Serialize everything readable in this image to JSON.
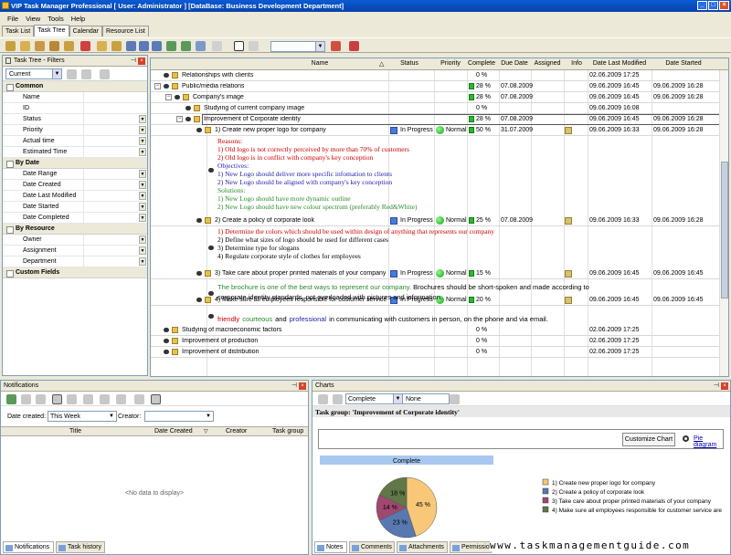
{
  "window": {
    "title": "VIP Task Manager Professional [ User: Administrator ] [DataBase: Business Development Department]"
  },
  "menu": [
    "File",
    "View",
    "Tools",
    "Help"
  ],
  "view_tabs": [
    "Task List",
    "Task Tree",
    "Calendar",
    "Resource List"
  ],
  "filter_panel": {
    "title": "Task Tree - Filters",
    "current": "Current",
    "sections": [
      {
        "name": "Common",
        "rows": [
          "Name",
          "ID",
          "Status",
          "Priority",
          "Actual time",
          "Estimated Time"
        ]
      },
      {
        "name": "By Date",
        "rows": [
          "Date Range",
          "Date Created",
          "Date Last Modified",
          "Date Started",
          "Date Completed"
        ]
      },
      {
        "name": "By Resource",
        "rows": [
          "Owner",
          "Assignment",
          "Department"
        ]
      },
      {
        "name": "Custom Fields",
        "rows": []
      }
    ]
  },
  "grid": {
    "columns": [
      "Name",
      "Status",
      "Priority",
      "Complete",
      "Due Date",
      "Assigned",
      "Info",
      "Date Last Modified",
      "Date Started"
    ],
    "rows": [
      {
        "name": "Relationships with clients",
        "status": "",
        "priority": "",
        "complete": "0 %",
        "due": "",
        "modified": "02.06.2009 17:25",
        "started": ""
      },
      {
        "name": "Public/media relations",
        "status": "",
        "priority": "",
        "complete": "28 %",
        "due": "07.08.2009",
        "modified": "09.06.2009 16:45",
        "started": "09.06.2009 16:28"
      },
      {
        "name": "Company's image",
        "status": "",
        "priority": "",
        "complete": "28 %",
        "due": "07.08.2009",
        "modified": "09.06.2009 16:45",
        "started": "09.06.2009 16:28"
      },
      {
        "name": "Studying of current company image",
        "status": "",
        "priority": "",
        "complete": "0 %",
        "due": "",
        "modified": "09.06.2009 16:08",
        "started": ""
      },
      {
        "name": "Improvement of Corporate identity",
        "status": "",
        "priority": "",
        "complete": "28 %",
        "due": "07.08.2009",
        "modified": "09.06.2009 16:45",
        "started": "09.06.2009 16:28"
      },
      {
        "name": "1) Create new proper logo for company",
        "status": "In Progress",
        "priority": "Normal",
        "complete": "50 %",
        "due": "31.07.2009",
        "modified": "09.06.2009 16:33",
        "started": "09.06.2009 16:28"
      },
      {
        "name": "2) Create a policy of corporate look",
        "status": "In Progress",
        "priority": "Normal",
        "complete": "25 %",
        "due": "07.08.2009",
        "modified": "09.06.2009 16:33",
        "started": "09.06.2009 16:28"
      },
      {
        "name": "3) Take care about proper printed materials of your company",
        "status": "In Progress",
        "priority": "Normal",
        "complete": "15 %",
        "due": "",
        "modified": "09.06.2009 16:45",
        "started": "09.06.2009 16:45"
      },
      {
        "name": "4) Make sure all employees responsible for customer service a",
        "status": "In Progress",
        "priority": "Normal",
        "complete": "20 %",
        "due": "",
        "modified": "09.06.2009 16:45",
        "started": "09.06.2009 16:45"
      },
      {
        "name": "Studying of macroeconomic factors",
        "status": "",
        "priority": "",
        "complete": "0 %",
        "due": "",
        "modified": "02.06.2009 17:25",
        "started": ""
      },
      {
        "name": "Improvement of production",
        "status": "",
        "priority": "",
        "complete": "0 %",
        "due": "",
        "modified": "02.06.2009 17:25",
        "started": ""
      },
      {
        "name": "Improvement of distribution",
        "status": "",
        "priority": "",
        "complete": "0 %",
        "due": "",
        "modified": "02.06.2009 17:25",
        "started": ""
      }
    ],
    "note1": {
      "reasons_title": "Reasons:",
      "reasons": [
        "1) Old logo is not correctly perceived by more than 70% of customers",
        "2) Old logo is in conflict with company's key conception"
      ],
      "objectives_title": "Objectives:",
      "objectives": [
        "1) New Logo should deliver more specific infomation to clients",
        "2) New Logo should be aligned with company's key conception"
      ],
      "solutions_title": "Solutions:",
      "solutions": [
        "1) New Logo should have more dynamic outline",
        "2) New Logo should have new colour spectrum (preferably Red&White)"
      ]
    },
    "note2": [
      "1) Determine the colors which should be used within design of anything that represents our company",
      "2) Define what sizes of logo should be used for different cases",
      "3) Determine type for slogans",
      "4) Regulate corporate style of clothes for employees"
    ],
    "note3": {
      "highlight": "The brochure is one of the best ways to represent our company.",
      "rest": " Brochures should be short-spoken and made according to",
      "line2": "corporate identity standards, not overloaded with pictures and information."
    },
    "note4": {
      "w1": "friendly",
      "w2": "courteous",
      "w3": "and",
      "w4": "professional",
      "rest": "in communicating with customers in person, on the phone and via email."
    }
  },
  "notifications": {
    "title": "Notifications",
    "date_created_label": "Date created:",
    "date_created_value": "This Week",
    "creator_label": "Creator:",
    "columns": [
      "Title",
      "Date Created",
      "Creator",
      "Task group"
    ],
    "empty": "<No data to display>",
    "tabs": [
      "Notifications",
      "Task history"
    ]
  },
  "charts": {
    "title": "Charts",
    "combo1": "Complete",
    "combo2": "None",
    "group_label": "Task group: 'Improvement of Corporate identity'",
    "customize": "Customize Chart",
    "pie_link": "Pie diagram",
    "tabs": [
      "Notes",
      "Comments",
      "Attachments",
      "Permissio"
    ]
  },
  "chart_data": {
    "type": "pie",
    "title": "Complete",
    "categories": [
      "1) Create new proper logo for company",
      "2) Create a policy of corporate look",
      "3) Take care about proper printed materials of your company",
      "4) Make sure all employees responsible for customer service are"
    ],
    "values": [
      45,
      23,
      14,
      18
    ],
    "labels": [
      "45 %",
      "23 %",
      "14 %",
      "18 %"
    ],
    "colors": [
      "#f8c878",
      "#5878b0",
      "#a04870",
      "#607848"
    ],
    "legend": "right"
  },
  "watermark": "www.taskmanagementguide.com"
}
